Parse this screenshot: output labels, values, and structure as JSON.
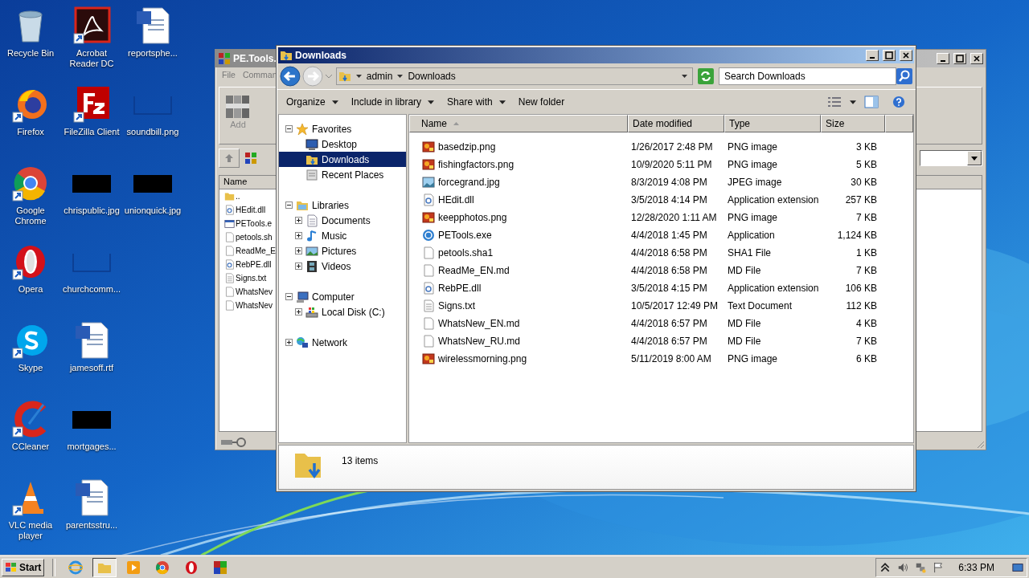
{
  "desktop_icons": [
    {
      "label": "Recycle Bin",
      "kind": "recycle",
      "shortcut": false
    },
    {
      "label": "Firefox",
      "kind": "firefox",
      "shortcut": true
    },
    {
      "label": "Google Chrome",
      "kind": "chrome",
      "shortcut": true
    },
    {
      "label": "Opera",
      "kind": "opera",
      "shortcut": true
    },
    {
      "label": "Skype",
      "kind": "skype",
      "shortcut": true
    },
    {
      "label": "CCleaner",
      "kind": "ccleaner",
      "shortcut": true
    },
    {
      "label": "VLC media player",
      "kind": "vlc",
      "shortcut": true
    },
    {
      "label": "Acrobat Reader DC",
      "kind": "acrobat",
      "shortcut": true
    },
    {
      "label": "FileZilla Client",
      "kind": "filezilla",
      "shortcut": true
    },
    {
      "label": "chrispublic.jpg",
      "kind": "dark-thumb",
      "shortcut": false
    },
    {
      "label": "churchcomm...",
      "kind": "blank-thumb",
      "shortcut": false
    },
    {
      "label": "jamesoff.rtf",
      "kind": "word",
      "shortcut": false
    },
    {
      "label": "mortgages...",
      "kind": "dark-thumb",
      "shortcut": false
    },
    {
      "label": "parentsstru...",
      "kind": "word",
      "shortcut": false
    },
    {
      "label": "reportsphe...",
      "kind": "word",
      "shortcut": false
    },
    {
      "label": "soundbill.png",
      "kind": "blank-thumb",
      "shortcut": false
    },
    {
      "label": "unionquick.jpg",
      "kind": "dark-thumb",
      "shortcut": false
    }
  ],
  "background_window": {
    "title": "PE.Tools.",
    "menu": [
      "File",
      "Comman"
    ],
    "toolbar_button": "Add",
    "column": "Name",
    "files": [
      {
        "name": "..",
        "kind": "folder"
      },
      {
        "name": "HEdit.dll",
        "kind": "dll"
      },
      {
        "name": "PETools.e",
        "kind": "exe"
      },
      {
        "name": "petools.sh",
        "kind": "blank"
      },
      {
        "name": "ReadMe_E",
        "kind": "blank"
      },
      {
        "name": "RebPE.dll",
        "kind": "dll"
      },
      {
        "name": "Signs.txt",
        "kind": "text"
      },
      {
        "name": "WhatsNev",
        "kind": "blank"
      },
      {
        "name": "WhatsNev",
        "kind": "blank"
      }
    ]
  },
  "explorer": {
    "title": "Downloads",
    "breadcrumb": [
      "admin",
      "Downloads"
    ],
    "search": {
      "placeholder": "Search Downloads"
    },
    "commands": [
      {
        "label": "Organize",
        "dropdown": true
      },
      {
        "label": "Include in library",
        "dropdown": true
      },
      {
        "label": "Share with",
        "dropdown": true
      },
      {
        "label": "New folder",
        "dropdown": false
      }
    ],
    "nav": [
      {
        "label": "Favorites",
        "kind": "star",
        "expanded": true,
        "selected": false,
        "children": [
          {
            "label": "Desktop",
            "kind": "desktop",
            "selected": false
          },
          {
            "label": "Downloads",
            "kind": "downloads",
            "selected": true
          },
          {
            "label": "Recent Places",
            "kind": "recent",
            "selected": false
          }
        ]
      },
      {
        "label": "Libraries",
        "kind": "library",
        "expanded": true,
        "selected": false,
        "children": [
          {
            "label": "Documents",
            "kind": "document",
            "expanded": false,
            "selected": false
          },
          {
            "label": "Music",
            "kind": "music",
            "expanded": false,
            "selected": false
          },
          {
            "label": "Pictures",
            "kind": "pictures",
            "expanded": false,
            "selected": false
          },
          {
            "label": "Videos",
            "kind": "videos",
            "expanded": false,
            "selected": false
          }
        ]
      },
      {
        "label": "Computer",
        "kind": "computer",
        "expanded": true,
        "selected": false,
        "children": [
          {
            "label": "Local Disk (C:)",
            "kind": "disk",
            "expanded": false,
            "selected": false
          }
        ]
      },
      {
        "label": "Network",
        "kind": "network",
        "expanded": false,
        "selected": false
      }
    ],
    "columns": [
      "Name",
      "Date modified",
      "Type",
      "Size"
    ],
    "files": [
      {
        "name": "basedzip.png",
        "date": "1/26/2017 2:48 PM",
        "type": "PNG image",
        "size": "3 KB",
        "kind": "png"
      },
      {
        "name": "fishingfactors.png",
        "date": "10/9/2020 5:11 PM",
        "type": "PNG image",
        "size": "5 KB",
        "kind": "png"
      },
      {
        "name": "forcegrand.jpg",
        "date": "8/3/2019 4:08 PM",
        "type": "JPEG image",
        "size": "30 KB",
        "kind": "jpg"
      },
      {
        "name": "HEdit.dll",
        "date": "3/5/2018 4:14 PM",
        "type": "Application extension",
        "size": "257 KB",
        "kind": "dll"
      },
      {
        "name": "keepphotos.png",
        "date": "12/28/2020 1:11 AM",
        "type": "PNG image",
        "size": "7 KB",
        "kind": "png"
      },
      {
        "name": "PETools.exe",
        "date": "4/4/2018 1:45 PM",
        "type": "Application",
        "size": "1,124 KB",
        "kind": "exe"
      },
      {
        "name": "petools.sha1",
        "date": "4/4/2018 6:58 PM",
        "type": "SHA1 File",
        "size": "1 KB",
        "kind": "blank"
      },
      {
        "name": "ReadMe_EN.md",
        "date": "4/4/2018 6:58 PM",
        "type": "MD File",
        "size": "7 KB",
        "kind": "blank"
      },
      {
        "name": "RebPE.dll",
        "date": "3/5/2018 4:15 PM",
        "type": "Application extension",
        "size": "106 KB",
        "kind": "dll"
      },
      {
        "name": "Signs.txt",
        "date": "10/5/2017 12:49 PM",
        "type": "Text Document",
        "size": "112 KB",
        "kind": "text"
      },
      {
        "name": "WhatsNew_EN.md",
        "date": "4/4/2018 6:57 PM",
        "type": "MD File",
        "size": "4 KB",
        "kind": "blank"
      },
      {
        "name": "WhatsNew_RU.md",
        "date": "4/4/2018 6:57 PM",
        "type": "MD File",
        "size": "7 KB",
        "kind": "blank"
      },
      {
        "name": "wirelessmorning.png",
        "date": "5/11/2019 8:00 AM",
        "type": "PNG image",
        "size": "6 KB",
        "kind": "png"
      }
    ],
    "status": "13 items"
  },
  "taskbar": {
    "start": "Start",
    "apps": [
      {
        "kind": "ie",
        "selected": false
      },
      {
        "kind": "explorer",
        "selected": true
      },
      {
        "kind": "media",
        "selected": false
      },
      {
        "kind": "chrome",
        "selected": false
      },
      {
        "kind": "opera",
        "selected": false
      },
      {
        "kind": "winrar",
        "selected": false
      }
    ],
    "clock": "6:33 PM"
  }
}
